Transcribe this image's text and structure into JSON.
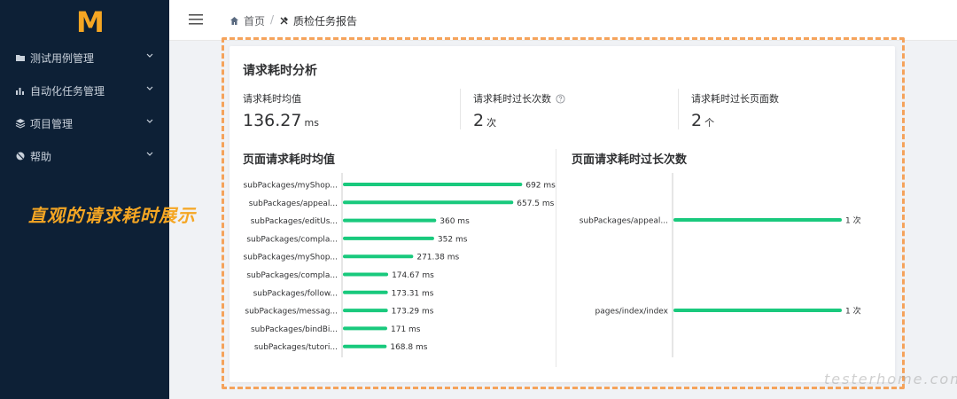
{
  "app": {
    "logo": "M"
  },
  "sidebar": {
    "items": [
      {
        "label": "测试用例管理",
        "icon": "folder-icon"
      },
      {
        "label": "自动化任务管理",
        "icon": "bar-chart-icon"
      },
      {
        "label": "项目管理",
        "icon": "layers-icon"
      },
      {
        "label": "帮助",
        "icon": "help-icon"
      }
    ]
  },
  "header": {
    "breadcrumb": {
      "home": "首页",
      "separator": "/",
      "current": "质检任务报告"
    }
  },
  "overlay": {
    "caption": "直观的请求耗时展示"
  },
  "report": {
    "title": "请求耗时分析",
    "stats": [
      {
        "label": "请求耗时均值",
        "value": "136.27",
        "unit": "ms"
      },
      {
        "label": "请求耗时过长次数",
        "value": "2",
        "unit": "次"
      },
      {
        "label": "请求耗时过长页面数",
        "value": "2",
        "unit": "个"
      }
    ]
  },
  "chart_data": [
    {
      "type": "bar",
      "orientation": "horizontal",
      "title": "页面请求耗时均值",
      "categories": [
        "subPackages/myShop...",
        "subPackages/appeal...",
        "subPackages/editUs...",
        "subPackages/compla...",
        "subPackages/myShop...",
        "subPackages/compla...",
        "subPackages/follow...",
        "subPackages/messag...",
        "subPackages/bindBi...",
        "subPackages/tutori..."
      ],
      "values": [
        692,
        657.5,
        360,
        352,
        271.38,
        174.67,
        173.31,
        173.29,
        171,
        168.8
      ],
      "labels": [
        "692 ms",
        "657.5 ms",
        "360 ms",
        "352 ms",
        "271.38 ms",
        "174.67 ms",
        "173.31 ms",
        "173.29 ms",
        "171 ms",
        "168.8 ms"
      ],
      "color": "#19c97d",
      "xlim": [
        0,
        725
      ]
    },
    {
      "type": "bar",
      "orientation": "horizontal",
      "title": "页面请求耗时过长次数",
      "categories": [
        "subPackages/appeal...",
        "pages/index/index"
      ],
      "values": [
        1,
        1
      ],
      "labels": [
        "1 次",
        "1 次"
      ],
      "color": "#19c97d",
      "xlim": [
        0,
        1
      ]
    }
  ],
  "watermark": "testerhome.com"
}
